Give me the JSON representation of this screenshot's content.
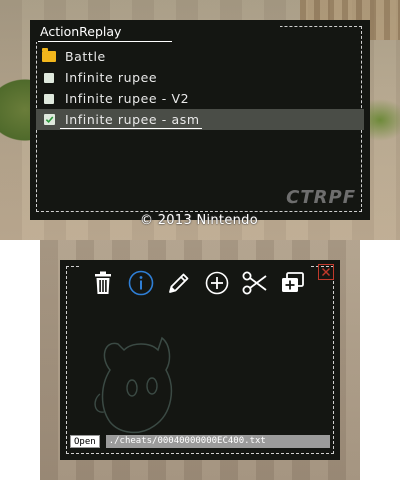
{
  "top_screen": {
    "copyright": "© 2013 Nintendo",
    "panel_title": "ActionReplay",
    "logo": "CTRPF",
    "items": [
      {
        "label": "Battle",
        "icon": "folder-icon"
      },
      {
        "label": "Infinite rupee",
        "icon": "checkbox-icon"
      },
      {
        "label": "Infinite rupee - V2",
        "icon": "checkbox-icon"
      },
      {
        "label": "Infinite rupee - asm",
        "icon": "checkbox-checked-icon",
        "selected": true
      }
    ]
  },
  "bottom_screen": {
    "toolbar": [
      "trash-icon",
      "info-icon",
      "pencil-icon",
      "add-icon",
      "scissors-icon",
      "duplicate-icon"
    ],
    "open_label": "Open",
    "file_path": "./cheats/00040000000EC400.txt"
  },
  "colors": {
    "panel_bg": "#141612",
    "selection_bg": "#4a4d47",
    "folder": "#f2b61c",
    "info_accent": "#2f7fd6",
    "close_accent": "#c0392b"
  }
}
